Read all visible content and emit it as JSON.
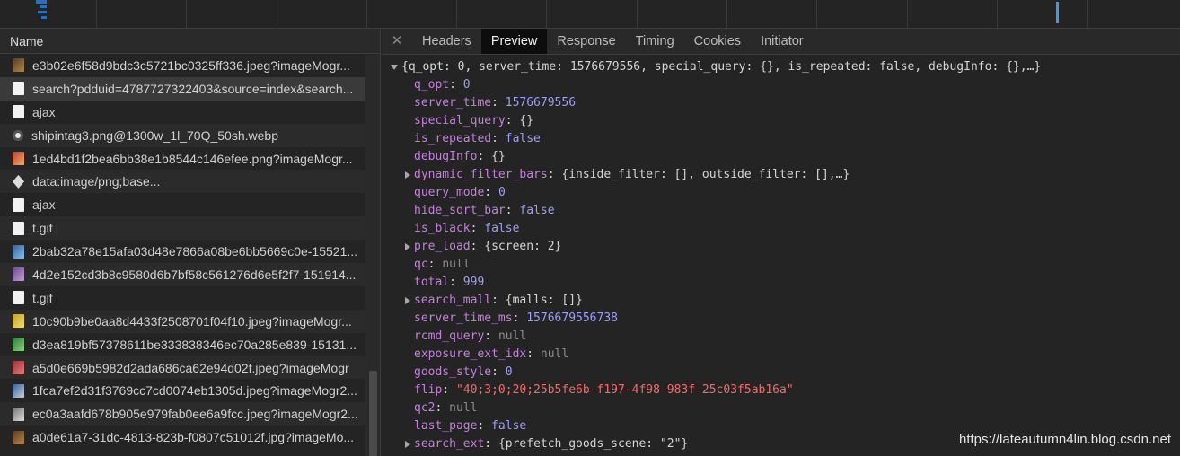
{
  "name_panel": {
    "header": "Name",
    "requests": [
      {
        "name": "e3b02e6f58d9bdc3c5721bc0325ff336.jpeg?imageMogr...",
        "icon": "img"
      },
      {
        "name": "search?pdduid=4787727322403&source=index&search...",
        "icon": "doc",
        "selected": true
      },
      {
        "name": "ajax",
        "icon": "doc"
      },
      {
        "name": "shipintag3.png@1300w_1l_70Q_50sh.webp",
        "icon": "webp"
      },
      {
        "name": "1ed4bd1f2bea6bb38e1b8544c146efee.png?imageMogr...",
        "icon": "img2"
      },
      {
        "name": "data:image/png;base...",
        "icon": "data"
      },
      {
        "name": "ajax",
        "icon": "doc"
      },
      {
        "name": "t.gif",
        "icon": "doc"
      },
      {
        "name": "2bab32a78e15afa03d48e7866a08be6bb5669c0e-15521...",
        "icon": "img3"
      },
      {
        "name": "4d2e152cd3b8c9580d6b7bf58c561276d6e5f2f7-151914...",
        "icon": "img4"
      },
      {
        "name": "t.gif",
        "icon": "doc"
      },
      {
        "name": "10c90b9be0aa8d4433f2508701f04f10.jpeg?imageMogr...",
        "icon": "img5"
      },
      {
        "name": "d3ea819bf57378611be333838346ec70a285e839-15131...",
        "icon": "img6"
      },
      {
        "name": "a5d0e669b5982d2ada686ca62e94d02f.jpeg?imageMogr",
        "icon": "img7"
      },
      {
        "name": "1fca7ef2d31f3769cc7cd0074eb1305d.jpeg?imageMogr2...",
        "icon": "img8"
      },
      {
        "name": "ec0a3aafd678b905e979fab0ee6a9fcc.jpeg?imageMogr2...",
        "icon": "img9"
      },
      {
        "name": "a0de61a7-31dc-4813-823b-f0807c51012f.jpg?imageMo...",
        "icon": "img"
      }
    ]
  },
  "detail_panel": {
    "close_glyph": "✕",
    "tabs": [
      {
        "label": "Headers"
      },
      {
        "label": "Preview",
        "active": true
      },
      {
        "label": "Response"
      },
      {
        "label": "Timing"
      },
      {
        "label": "Cookies"
      },
      {
        "label": "Initiator"
      }
    ],
    "preview_lines": [
      {
        "indent": 0,
        "toggle": "down",
        "text": "{q_opt: 0, server_time: 1576679556, special_query: {}, is_repeated: false, debugInfo: {},…}",
        "kind": "summary"
      },
      {
        "indent": 1,
        "key": "q_opt",
        "value": "0",
        "vtype": "n"
      },
      {
        "indent": 1,
        "key": "server_time",
        "value": "1576679556",
        "vtype": "n"
      },
      {
        "indent": 1,
        "key": "special_query",
        "value": "{}",
        "vtype": "p"
      },
      {
        "indent": 1,
        "key": "is_repeated",
        "value": "false",
        "vtype": "b"
      },
      {
        "indent": 1,
        "key": "debugInfo",
        "value": "{}",
        "vtype": "p"
      },
      {
        "indent": 1,
        "toggle": "right",
        "key": "dynamic_filter_bars",
        "value": "{inside_filter: [], outside_filter: [],…}",
        "vtype": "p"
      },
      {
        "indent": 1,
        "key": "query_mode",
        "value": "0",
        "vtype": "n"
      },
      {
        "indent": 1,
        "key": "hide_sort_bar",
        "value": "false",
        "vtype": "b"
      },
      {
        "indent": 1,
        "key": "is_black",
        "value": "false",
        "vtype": "b"
      },
      {
        "indent": 1,
        "toggle": "right",
        "key": "pre_load",
        "value": "{screen: 2}",
        "vtype": "p"
      },
      {
        "indent": 1,
        "key": "qc",
        "value": "null",
        "vtype": "nl"
      },
      {
        "indent": 1,
        "key": "total",
        "value": "999",
        "vtype": "n"
      },
      {
        "indent": 1,
        "toggle": "right",
        "key": "search_mall",
        "value": "{malls: []}",
        "vtype": "p"
      },
      {
        "indent": 1,
        "key": "server_time_ms",
        "value": "1576679556738",
        "vtype": "n"
      },
      {
        "indent": 1,
        "key": "rcmd_query",
        "value": "null",
        "vtype": "nl"
      },
      {
        "indent": 1,
        "key": "exposure_ext_idx",
        "value": "null",
        "vtype": "nl"
      },
      {
        "indent": 1,
        "key": "goods_style",
        "value": "0",
        "vtype": "n"
      },
      {
        "indent": 1,
        "key": "flip",
        "value": "\"40;3;0;20;25b5fe6b-f197-4f98-983f-25c03f5ab16a\"",
        "vtype": "s"
      },
      {
        "indent": 1,
        "key": "qc2",
        "value": "null",
        "vtype": "nl"
      },
      {
        "indent": 1,
        "key": "last_page",
        "value": "false",
        "vtype": "b"
      },
      {
        "indent": 1,
        "toggle": "right",
        "key": "search_ext",
        "value": "{prefetch_goods_scene: \"2\"}",
        "vtype": "p"
      }
    ]
  },
  "watermark": "https://lateautumn4lin.blog.csdn.net",
  "colors": {
    "background": "#242424",
    "active_tab": "#0d0d0d",
    "key": "#c77fe0",
    "number": "#9e9ef5",
    "string": "#f26b6b",
    "null": "#8c8c8c"
  }
}
